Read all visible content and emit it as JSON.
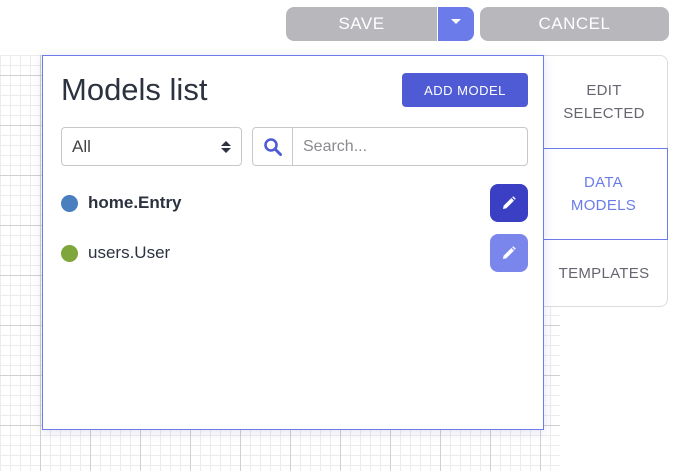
{
  "toolbar": {
    "save_label": "SAVE",
    "cancel_label": "CANCEL"
  },
  "side_tabs": [
    {
      "label": "EDIT\nSELECTED",
      "active": false
    },
    {
      "label": "DATA\nMODELS",
      "active": true
    },
    {
      "label": "TEMPLATES",
      "active": false
    }
  ],
  "panel": {
    "title": "Models list",
    "add_button_label": "ADD MODEL",
    "filter": {
      "selected": "All"
    },
    "search": {
      "placeholder": "Search...",
      "value": ""
    }
  },
  "models": [
    {
      "name": "home.Entry",
      "dot_color": "#4a7fbf",
      "edit_button_color": "#3b3fc4"
    },
    {
      "name": "users.User",
      "dot_color": "#7ea63a",
      "edit_button_color": "#7b86ec"
    }
  ],
  "colors": {
    "accent": "#6b7bea",
    "primary_button": "#4f5bd5",
    "disabled_button": "#b8b8bc"
  },
  "icons": {
    "search": "search-icon",
    "edit": "pencil-icon",
    "caret": "chevron-down-icon",
    "select_arrows": "sort-arrows-icon"
  }
}
